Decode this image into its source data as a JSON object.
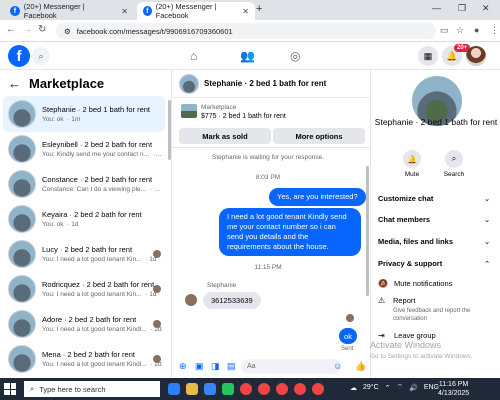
{
  "browser": {
    "tabs": [
      {
        "title": "(20+) Messenger | Facebook",
        "active": false
      },
      {
        "title": "(20+) Messenger | Facebook",
        "active": true
      }
    ],
    "url": "facebook.com/messages/t/9906916709360601"
  },
  "header": {
    "notification_count": "20+"
  },
  "marketplace": {
    "title": "Marketplace",
    "conversations": [
      {
        "title": "Stephanie · 2 bed 1 bath for rent",
        "subtitle": "You: ok",
        "time": "· 1m",
        "active": true
      },
      {
        "title": "Esleynibell · 2 bed 2 bath for rent",
        "subtitle": "You: Kindly send me your contact n...",
        "time": "· 3h",
        "active": false
      },
      {
        "title": "Constance · 2 bed 2 bath for rent",
        "subtitle": "Constance: Can I do a viewing ple...",
        "time": "· 22h",
        "active": false
      },
      {
        "title": "Keyaira · 2 bed 2 bath for rent",
        "subtitle": "You: ok",
        "time": "· 1d",
        "active": false
      },
      {
        "title": "Lucy · 2 bed 2 bath for rent",
        "subtitle": "You: I need a lot good tenant Kin...",
        "time": "· 1d",
        "active": false
      },
      {
        "title": "Rodricquez · 2 bed 2 bath for rent",
        "subtitle": "You: I need a lot good tenant Kin...",
        "time": "· 1d",
        "active": false
      },
      {
        "title": "Adore · 2 bed 2 bath for rent",
        "subtitle": "You: I need a lot good tenant Kindl...",
        "time": "· 2d",
        "active": false
      },
      {
        "title": "Mena · 2 bed 2 bath for rent",
        "subtitle": "You: I need a lot good tenant Kindl...",
        "time": "· 2d",
        "active": false
      }
    ]
  },
  "chat": {
    "title": "Stephanie · 2 bed 1 bath for rent",
    "listing_label": "Marketplace",
    "listing_price": "$775 · 2 bed 1 bath for rent",
    "mark_sold": "Mark as sold",
    "more_options": "More options",
    "waiting": "Stephanie is waiting for your response.",
    "time1": "8:03 PM",
    "msg1": "Yes, are you interested?",
    "msg2": "I need a lot good tenant Kindly send me your contact number so i can send you details and the requirements about the house.",
    "time2": "11:15 PM",
    "sender": "Stephanie",
    "incoming": "3612533639",
    "msg3": "ok",
    "sent": "Sent",
    "composer_placeholder": "Aa"
  },
  "details": {
    "title": "Stephanie · 2 bed 1 bath for rent",
    "mute": "Mute",
    "search": "Search",
    "sections": [
      "Customize chat",
      "Chat members",
      "Media, files and links",
      "Privacy & support"
    ],
    "mute_notifications": "Mute notifications",
    "report": "Report",
    "report_sub": "Give feedback and report the conversation",
    "leave": "Leave group"
  },
  "watermark": {
    "line1": "Activate Windows",
    "line2": "Go to Settings to activate Windows."
  },
  "taskbar": {
    "search_placeholder": "Type here to search",
    "temperature": "29°C",
    "lang": "ENG",
    "time": "11:16 PM",
    "date": "4/13/2025"
  }
}
